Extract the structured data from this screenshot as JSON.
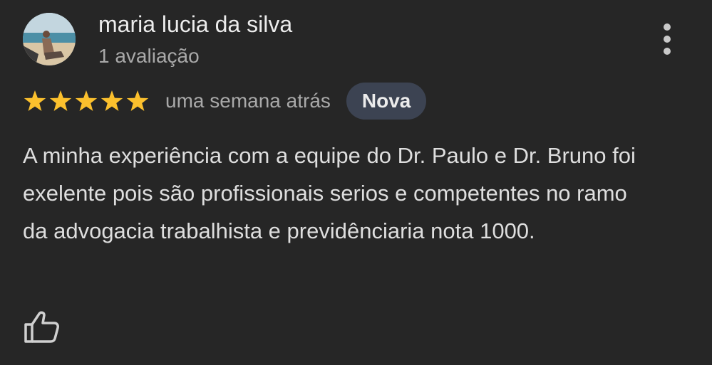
{
  "review": {
    "author_name": "maria lucia da silva",
    "review_count": "1 avaliação",
    "rating": 5,
    "rating_max": 5,
    "time_ago": "uma semana atrás",
    "badge": "Nova",
    "text": "A minha experiência com a equipe do Dr. Paulo e Dr. Bruno foi exelente pois são profissionais serios e competentes no ramo da advogacia trabalhista e previdênciaria nota 1000."
  },
  "icons": {
    "avatar": "profile-photo",
    "more": "more-vert-icon",
    "star": "star-icon",
    "like": "thumbs-up-icon"
  },
  "colors": {
    "background": "#262626",
    "star": "#fbc02d",
    "badge_background": "#3c4352",
    "text_primary": "#ececec",
    "text_secondary": "#a9a9a9"
  }
}
